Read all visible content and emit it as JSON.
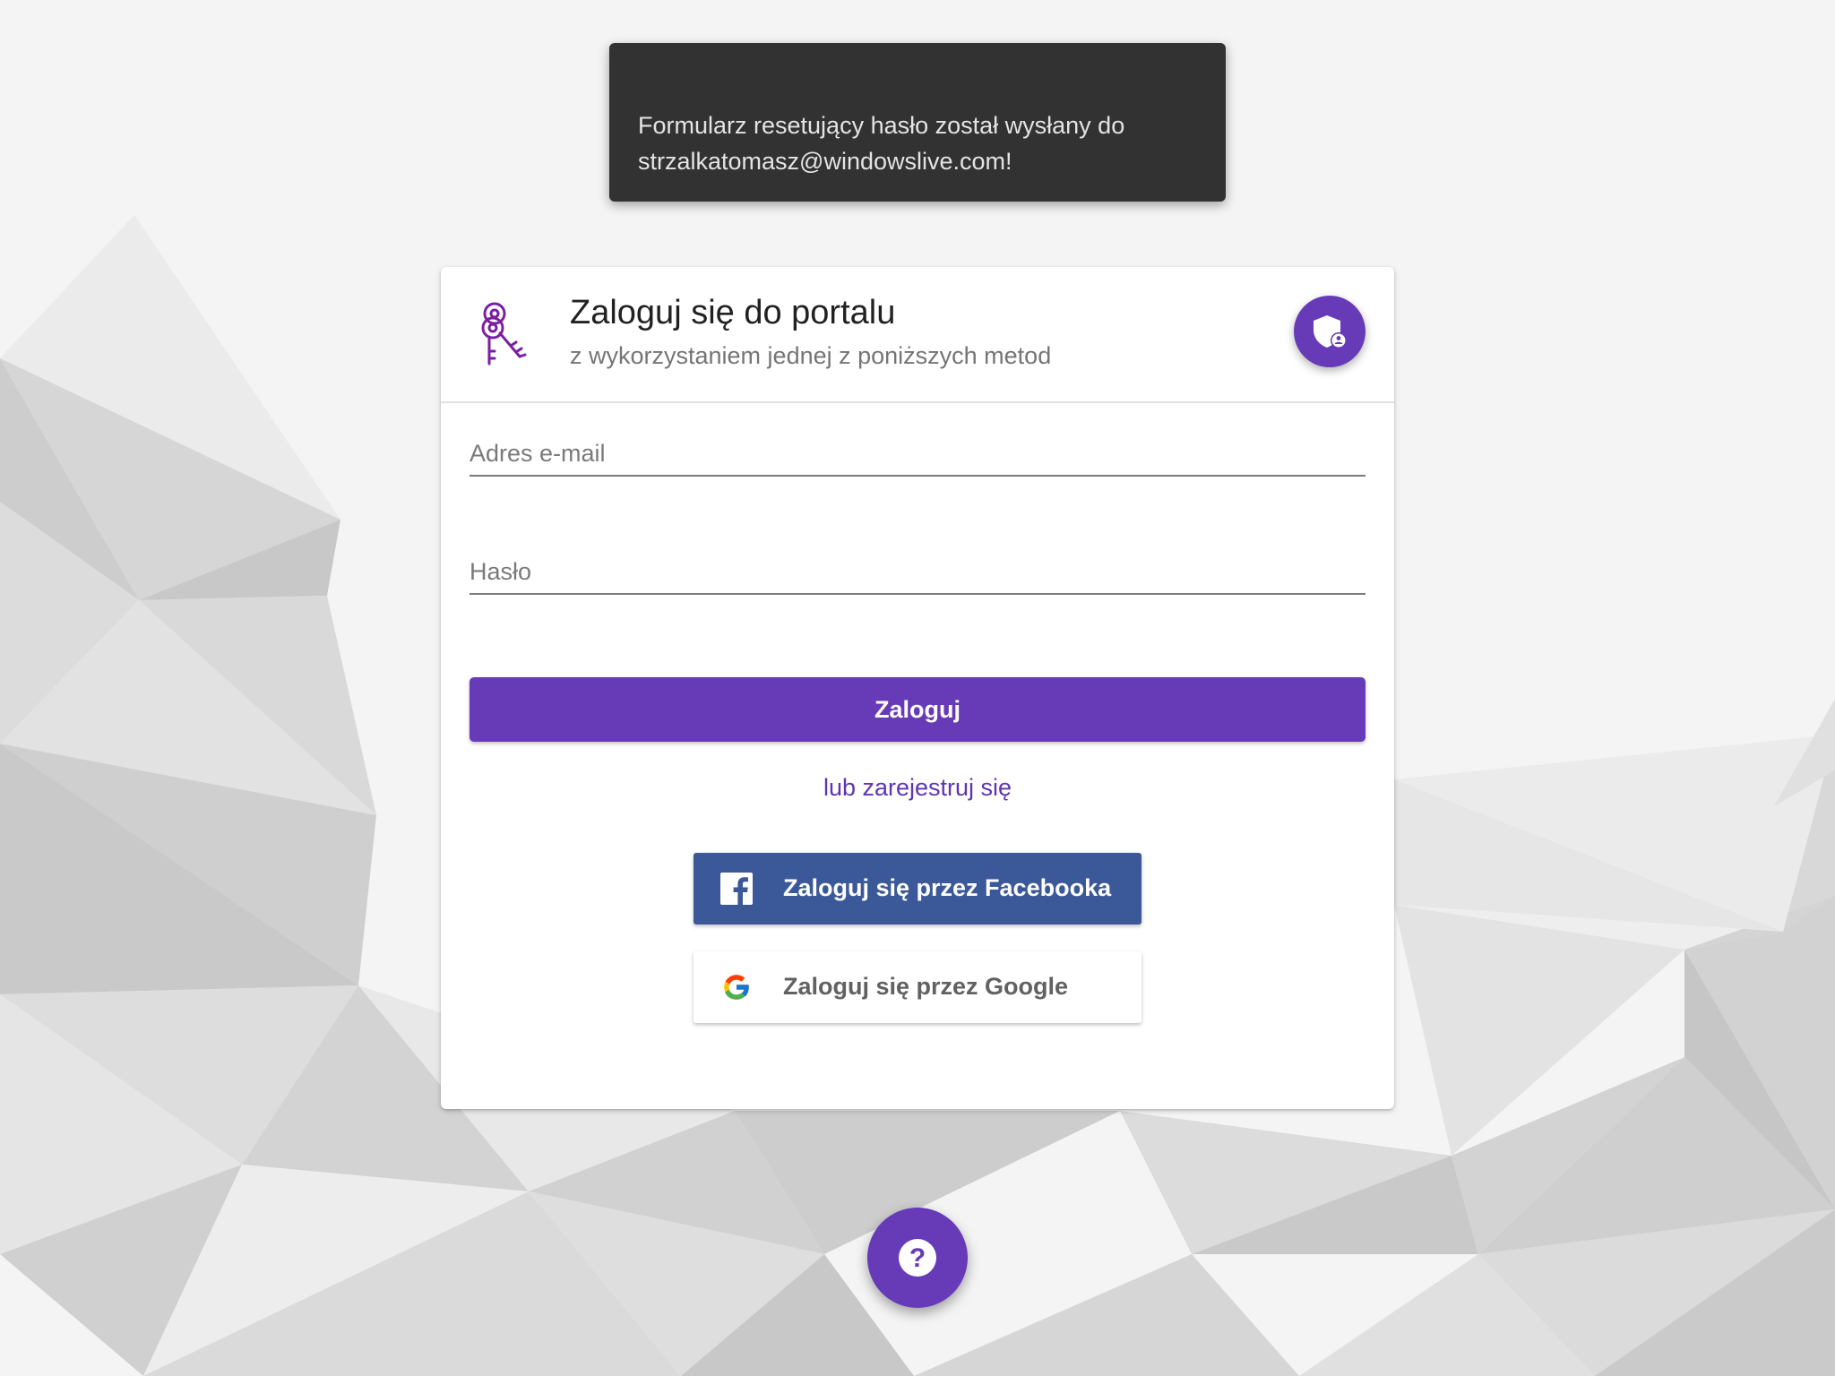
{
  "snackbar": {
    "line1": "Formularz resetujący hasło został wysłany do",
    "line2": "strzalkatomasz@windowslive.com!"
  },
  "card": {
    "title": "Zaloguj się do portalu",
    "subtitle": "z wykorzystaniem jednej z poniższych metod",
    "header_icon": "keys-icon",
    "avatar_icon": "shield-user-icon"
  },
  "form": {
    "email_placeholder": "Adres e-mail",
    "email_value": "",
    "password_placeholder": "Hasło",
    "password_value": "",
    "login_label": "Zaloguj",
    "register_label": "lub zarejestruj się"
  },
  "social": {
    "facebook_label": "Zaloguj się przez Facebooka",
    "google_label": "Zaloguj się przez Google"
  },
  "help": {
    "icon": "help-icon"
  },
  "colors": {
    "primary": "#673ab7",
    "link": "#5e35b1",
    "facebook": "#3b5998",
    "snackbar": "#323232"
  }
}
